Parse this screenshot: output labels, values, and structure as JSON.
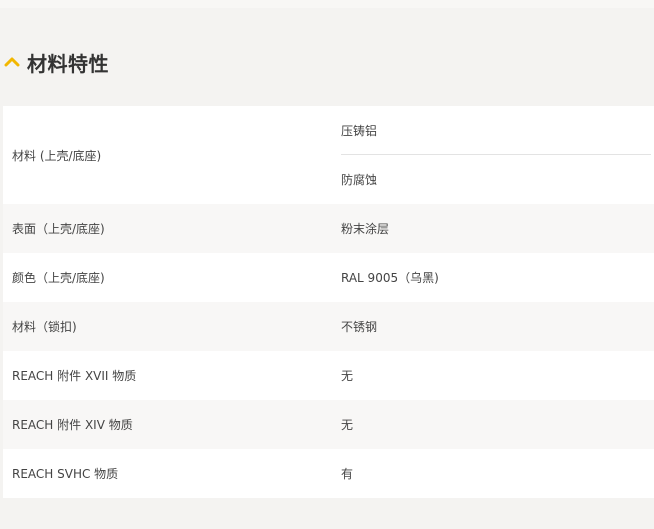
{
  "section": {
    "title": "材料特性",
    "accent_color": "#f2b700",
    "icon": "chevron-up-icon"
  },
  "rows": [
    {
      "label": "材料 (上壳/底座)",
      "values": [
        "压铸铝",
        "防腐蚀"
      ]
    },
    {
      "label": "表面（上壳/底座)",
      "value": "粉末涂层"
    },
    {
      "label": "颜色（上壳/底座)",
      "value": "RAL 9005（乌黑)"
    },
    {
      "label": "材料（锁扣)",
      "value": "不锈钢"
    },
    {
      "label": "REACH 附件 XVII 物质",
      "value": "无"
    },
    {
      "label": "REACH 附件 XIV 物质",
      "value": "无"
    },
    {
      "label": "REACH SVHC 物质",
      "value": "有"
    }
  ]
}
